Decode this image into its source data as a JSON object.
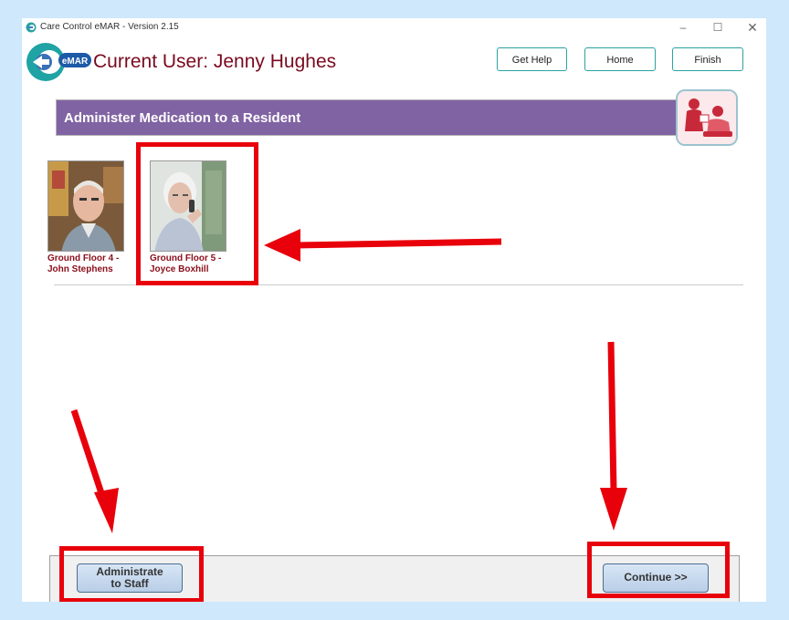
{
  "window": {
    "title": "Care Control eMAR - Version 2.15",
    "controls": [
      "–",
      "☐",
      "✕"
    ]
  },
  "header": {
    "logo_badge": "eMAR",
    "current_user": "Current User: Jenny Hughes",
    "buttons": {
      "help": "Get Help",
      "home": "Home",
      "finish": "Finish"
    }
  },
  "banner": {
    "title": "Administer Medication to a Resident",
    "icon": "nurse-with-resident-icon"
  },
  "residents": [
    {
      "line1": "Ground Floor 4 -",
      "line2": "John Stephens"
    },
    {
      "line1": "Ground Floor 5 -",
      "line2": "Joyce Boxhill"
    }
  ],
  "footer": {
    "staff_line1": "Administrate",
    "staff_line2": "to Staff",
    "continue_label": "Continue >>"
  },
  "colors": {
    "banner": "#8063a3",
    "user_text": "#7a0a1f",
    "teal_border": "#2aa3a0",
    "highlight": "#e8000b",
    "page_bg": "#cfe8fb"
  }
}
